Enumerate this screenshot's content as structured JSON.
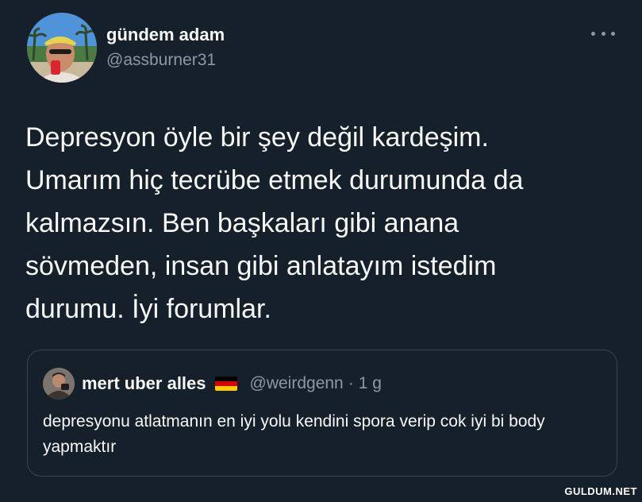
{
  "tweet": {
    "author": {
      "name": "gündem adam",
      "handle": "@assburner31"
    },
    "text": "Depresyon öyle bir şey değil kardeşim.\nUmarım hiç tecrübe etmek durumunda da\nkalmazsın. Ben başkaları gibi anana\nsövmeden, insan gibi anlatayım istedim\ndurumu. İyi forumlar.",
    "more_icon": "more-horizontal-icon"
  },
  "quote": {
    "author": {
      "name": "mert uber alles",
      "handle": "@weirdgenn",
      "flag_icon": "germany-flag-icon"
    },
    "separator": "·",
    "time": "1 g",
    "text": "depresyonu atlatmanın en iyi yolu kendini spora verip cok iyi bi body yapmaktır"
  },
  "watermark": "GULDUM.NET",
  "colors": {
    "background": "#15202b",
    "text_primary": "#f7f9f9",
    "text_secondary": "#8b98a5",
    "border": "#38444d",
    "flag": [
      "#000000",
      "#dd0000",
      "#ffce00"
    ]
  }
}
